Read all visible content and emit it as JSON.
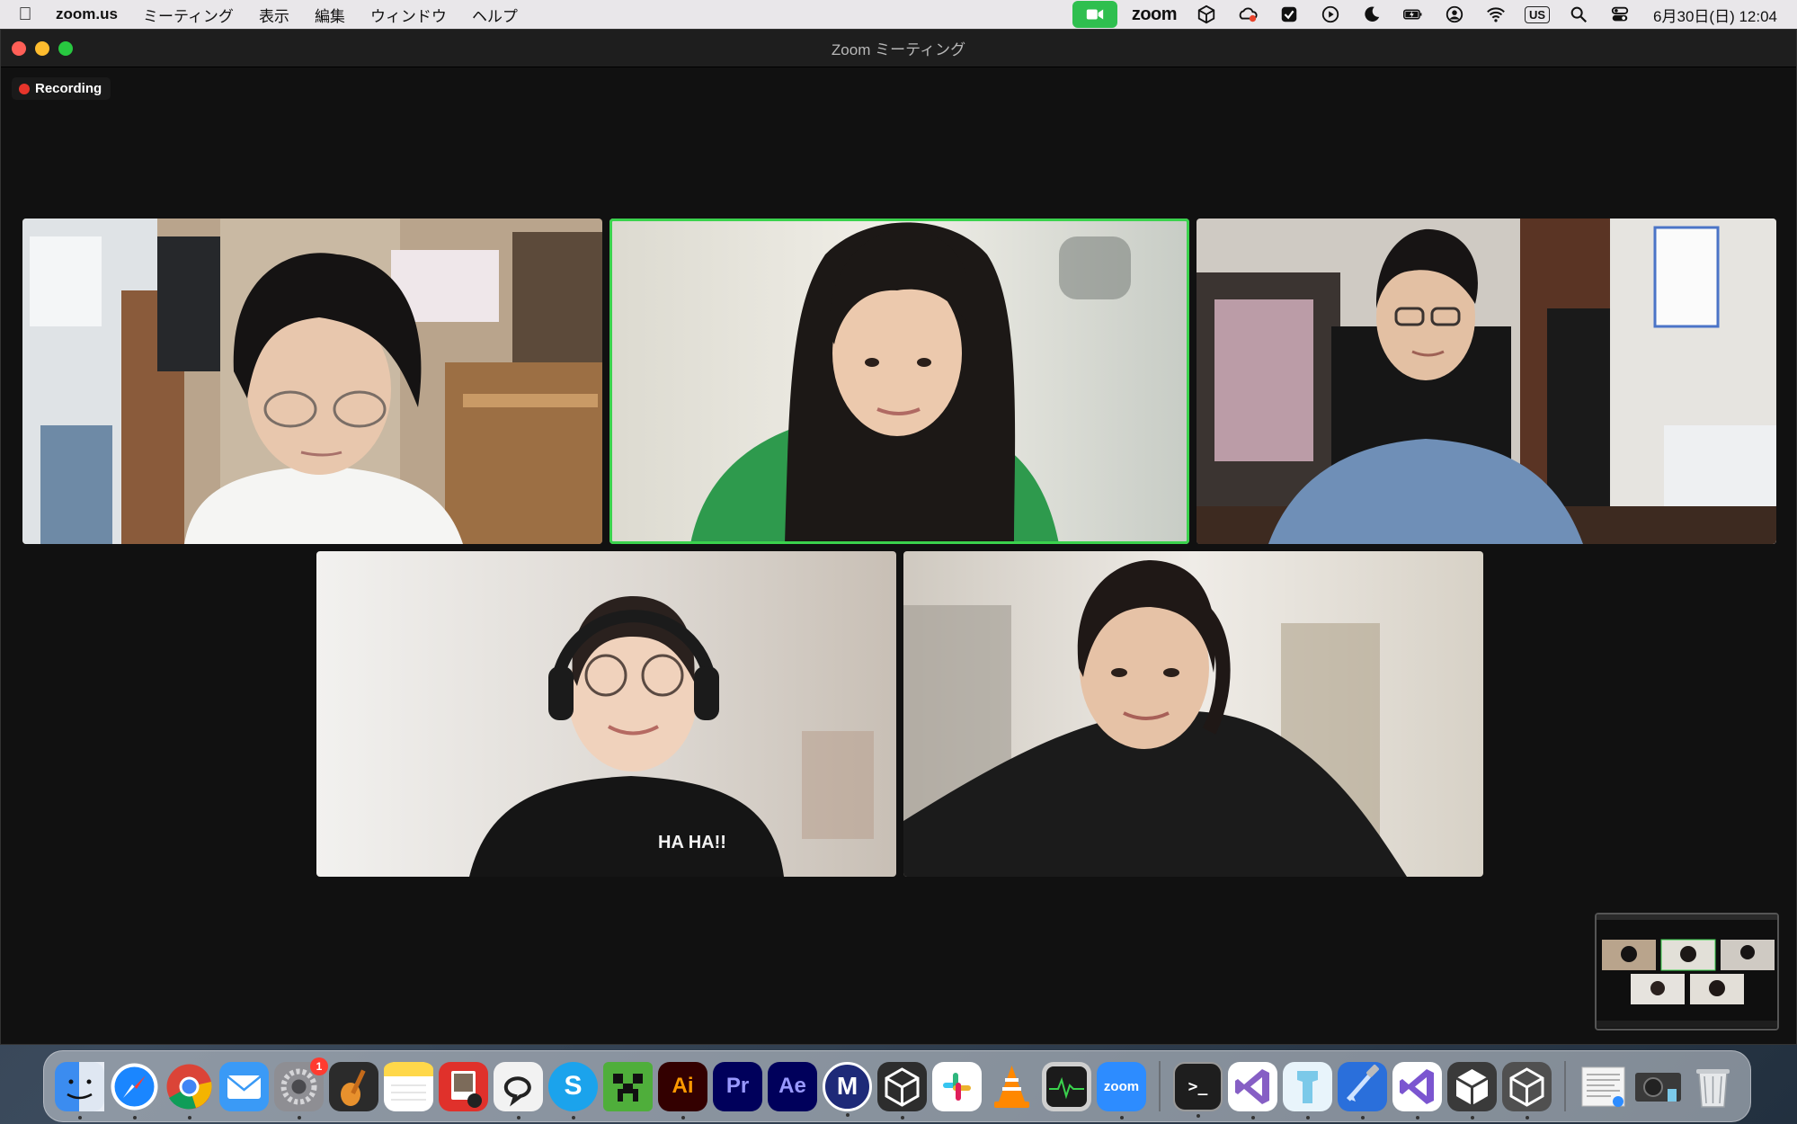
{
  "menubar": {
    "app_name": "zoom.us",
    "menus": [
      "ミーティング",
      "表示",
      "編集",
      "ウィンドウ",
      "ヘルプ"
    ],
    "status_zoom": "zoom",
    "input_source": "US",
    "clock": "6月30日(日)  12:04"
  },
  "window": {
    "title": "Zoom ミーティング",
    "recording_label": "Recording"
  },
  "participants": [
    {
      "tile": "top-left",
      "active_speaker": false
    },
    {
      "tile": "top-center",
      "active_speaker": true
    },
    {
      "tile": "top-right",
      "active_speaker": false
    },
    {
      "tile": "bottom-left",
      "active_speaker": false
    },
    {
      "tile": "bottom-right",
      "active_speaker": false
    }
  ],
  "dock": {
    "apps": [
      {
        "name": "finder-icon",
        "text": "",
        "color": "#3b8cf0"
      },
      {
        "name": "safari-icon",
        "text": "",
        "color": "#1a86ff"
      },
      {
        "name": "chrome-icon",
        "text": "",
        "color": "#ffffff"
      },
      {
        "name": "mail-icon",
        "text": "",
        "color": "#3a9af6"
      },
      {
        "name": "system-settings-icon",
        "text": "",
        "color": "#8e8e93",
        "badge": "1"
      },
      {
        "name": "garageband-icon",
        "text": "",
        "color": "#2b2b2b"
      },
      {
        "name": "notes-icon",
        "text": "",
        "color": "#ffd84a"
      },
      {
        "name": "photo-booth-icon",
        "text": "",
        "color": "#e0312b"
      },
      {
        "name": "line-icon",
        "text": "",
        "color": "#f2f2f2"
      },
      {
        "name": "skype-icon",
        "text": "S",
        "color": "#1ba3ec"
      },
      {
        "name": "minecraft-icon",
        "text": "",
        "color": "#4fae3b"
      },
      {
        "name": "illustrator-icon",
        "text": "Ai",
        "color": "#330000",
        "fg": "#ff9a00"
      },
      {
        "name": "premiere-icon",
        "text": "Pr",
        "color": "#00005b",
        "fg": "#9999ff"
      },
      {
        "name": "after-effects-icon",
        "text": "Ae",
        "color": "#00005b",
        "fg": "#9999ff"
      },
      {
        "name": "m-app-icon",
        "text": "M",
        "color": "#1e2a78"
      },
      {
        "name": "unity-hub-icon",
        "text": "",
        "color": "#2d2d2d"
      },
      {
        "name": "slack-icon",
        "text": "",
        "color": "#ffffff"
      },
      {
        "name": "vlc-icon",
        "text": "",
        "color": "transparent"
      },
      {
        "name": "activity-monitor-icon",
        "text": "",
        "color": "#1b1b1b"
      },
      {
        "name": "zoom-app-icon",
        "text": "zoom",
        "color": "#2d8cff"
      },
      {
        "name": "terminal-icon",
        "text": ">_",
        "color": "#1e1e1e"
      },
      {
        "name": "visual-studio-icon",
        "text": "",
        "color": "#ffffff"
      },
      {
        "name": "blue-app-icon",
        "text": "",
        "color": "#e8f4fb"
      },
      {
        "name": "xcode-icon",
        "text": "",
        "color": "#2a6fdb"
      },
      {
        "name": "visual-studio-2-icon",
        "text": "",
        "color": "#ffffff"
      },
      {
        "name": "unity-icon",
        "text": "",
        "color": "#333333"
      },
      {
        "name": "unity-2-icon",
        "text": "",
        "color": "#444444"
      },
      {
        "name": "document-preview-icon",
        "text": "",
        "color": "#f4f4f4"
      },
      {
        "name": "screen-capture-icon",
        "text": "",
        "color": "#3a3a3a"
      },
      {
        "name": "trash-icon",
        "text": "",
        "color": "transparent"
      }
    ]
  }
}
